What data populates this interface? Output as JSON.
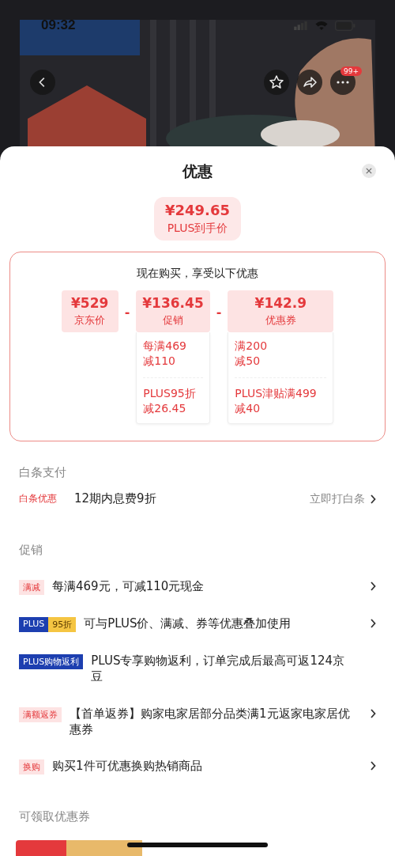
{
  "status_bar": {
    "time": "09:32"
  },
  "top_bar": {
    "badge": "99+"
  },
  "sheet": {
    "title": "优惠"
  },
  "final_price": {
    "price": "¥249.65",
    "label": "PLUS到手价"
  },
  "breakdown": {
    "intro": "现在购买，享受以下优惠",
    "components": [
      {
        "price": "¥529",
        "label": "京东价"
      },
      {
        "price": "¥136.45",
        "label": "促销",
        "operator": "-",
        "details": [
          [
            "每满469",
            "减110"
          ],
          [
            "PLUS95折",
            "减26.45"
          ]
        ]
      },
      {
        "price": "¥142.9",
        "label": "优惠券",
        "operator": "-",
        "details": [
          [
            "满200",
            "减50"
          ],
          [
            "PLUS津贴满499",
            "减40"
          ]
        ]
      }
    ]
  },
  "baitiao": {
    "title": "白条支付",
    "tag": "白条优惠",
    "text": "12期内息费9折",
    "action": "立即打白条"
  },
  "promotions": {
    "title": "促销",
    "items": [
      {
        "tags": [
          {
            "kind": "light",
            "text": "满减"
          }
        ],
        "text": "每满469元，可减110元现金",
        "arrow": true
      },
      {
        "tags": [
          {
            "kind": "plus",
            "text": "PLUS"
          },
          {
            "kind": "gold",
            "text": "95折"
          }
        ],
        "text": "可与PLUS价、满减、券等优惠叠加使用",
        "arrow": true
      },
      {
        "tags": [
          {
            "kind": "plus",
            "text": "PLUS购物返利"
          }
        ],
        "text": "PLUS专享购物返利，订单完成后最高可返124京豆",
        "arrow": false
      },
      {
        "tags": [
          {
            "kind": "light",
            "text": "满额返券"
          }
        ],
        "text": "【首单返券】购家电家居部分品类满1元返家电家居优惠券",
        "arrow": true
      },
      {
        "tags": [
          {
            "kind": "light",
            "text": "换购"
          }
        ],
        "text": "购买1件可优惠换购热销商品",
        "arrow": true
      }
    ]
  },
  "coupons": {
    "title": "可领取优惠券"
  }
}
